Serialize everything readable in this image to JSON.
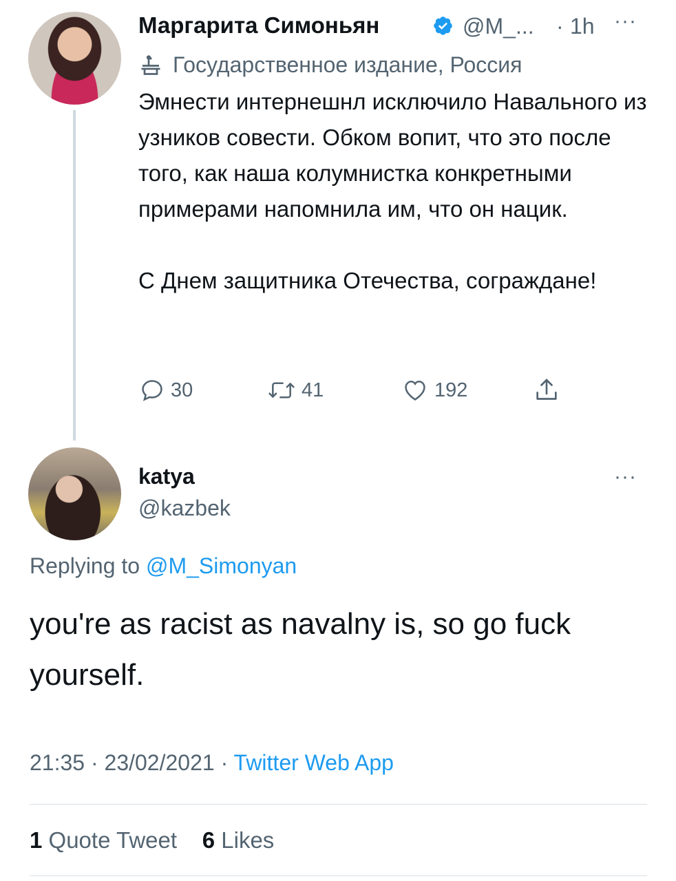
{
  "parent_tweet": {
    "author_name": "Маргарита Симоньян",
    "handle": "@M_...",
    "separator": "·",
    "time": "1h",
    "more": "···",
    "state_label": "Государственное издание, Россия",
    "text": "Эмнести интернешнл исключило Навального из узников совести. Обком вопит, что это после того, как наша колумнистка конкретными примерами напомнила им, что он нацик.\n\nС Днем защитника Отечества, сограждане!",
    "replies": "30",
    "retweets": "41",
    "likes": "192"
  },
  "reply_tweet": {
    "author_name": "katya",
    "handle": "@kazbek",
    "more": "···",
    "replying_to_prefix": "Replying to ",
    "replying_to_handle": "@M_Simonyan",
    "text": "you're as racist as navalny is, so go fuck yourself.",
    "time": "21:35",
    "date": "23/02/2021",
    "meta_sep": "·",
    "source": "Twitter Web App",
    "quote_count": "1",
    "quote_label": "Quote Tweet",
    "like_count": "6",
    "like_label": "Likes"
  },
  "colors": {
    "link": "#1d9bf0",
    "muted": "#536471",
    "text": "#0f1419",
    "verified": "#1d9bf0"
  },
  "icons": {
    "verified": "verified-badge-icon",
    "state": "podium-icon",
    "reply": "reply-bubble-icon",
    "retweet": "retweet-icon",
    "like": "heart-icon",
    "share": "share-icon",
    "more": "more-dots-icon"
  }
}
